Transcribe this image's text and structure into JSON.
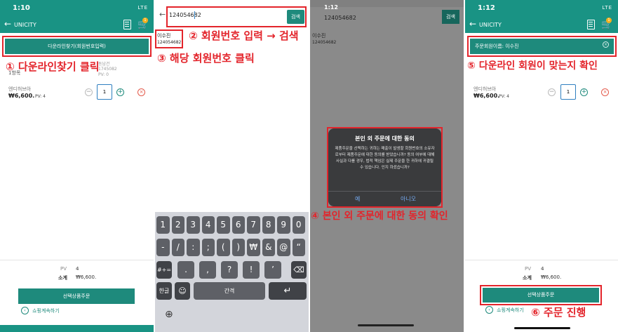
{
  "panel1": {
    "time": "1:10",
    "status": "LTE",
    "app_title": "UNICITY",
    "cart_badge": "1",
    "find_button": "다운라인찾기(회원번호입력)",
    "step1": "① 다운라인찾기 클릭",
    "ghost1": "동남건",
    "ghost2": "1745082",
    "ghost3": "PV: 0",
    "item_count": "1항목",
    "item_name": "엔디허브아",
    "price": "₩6,600.",
    "pv": "PV: 4",
    "qty": "1",
    "sum_pv_label": "PV",
    "sum_pv_value": "4",
    "sum_total_label": "소계",
    "sum_total_value": "₩6,600.",
    "order_button": "선택상품주문",
    "continue_link": "쇼핑계속하기"
  },
  "panel2": {
    "search_value": "124054682",
    "search_button": "검색",
    "step2": "② 회원번호 입력 → 검색",
    "result_name": "이수진",
    "result_id": "124054682",
    "step3": "③ 해당 회원번호 클릭",
    "keys_row1": [
      "1",
      "2",
      "3",
      "4",
      "5",
      "6",
      "7",
      "8",
      "9",
      "0"
    ],
    "keys_row2": [
      "-",
      "/",
      ":",
      ";",
      "(",
      ")",
      "₩",
      "&",
      "@",
      "“"
    ],
    "keys_row3": [
      ".",
      ",",
      "?",
      "!",
      "’"
    ],
    "key_sym": "#+=",
    "key_lang": "한글",
    "key_space": "간격"
  },
  "panel3": {
    "time": "1:12",
    "search_value": "124054682",
    "search_button": "검색",
    "result_name": "이수진",
    "result_id": "124054682",
    "dialog_title": "본인 외 주문에 대한 동의",
    "dialog_body": "제품주문을 선택하는 귀하는 매출이 발생할 회원번호의 소유자로부터 제품주문에 대한 동의를 받았습니까? 동의 여부에 대해 사실과 다를 경우, 법적 책임은 실제 주문을 한 귀하에 귀결될 수 있습니다. 인지 하셨습니까?",
    "yes": "예",
    "no": "아니오",
    "step4": "④ 본인 외 주문에 대한 동의 확인"
  },
  "panel4": {
    "time": "1:12",
    "app_title": "UNICITY",
    "member_field": "주문회원이름: 이수진",
    "step5": "⑤ 다운라인 회원이 맞는지 확인",
    "item_name": "엔디허브아",
    "price": "₩6,600.",
    "pv": "PV: 4",
    "qty": "1",
    "sum_pv_label": "PV",
    "sum_pv_value": "4",
    "sum_total_label": "소계",
    "sum_total_value": "₩6,600.",
    "order_button": "선택상품주문",
    "continue_link": "쇼핑계속하기",
    "step6": "⑥ 주문 진행"
  },
  "colors": {
    "teal": "#199384",
    "red_annotation": "#e3242b"
  }
}
